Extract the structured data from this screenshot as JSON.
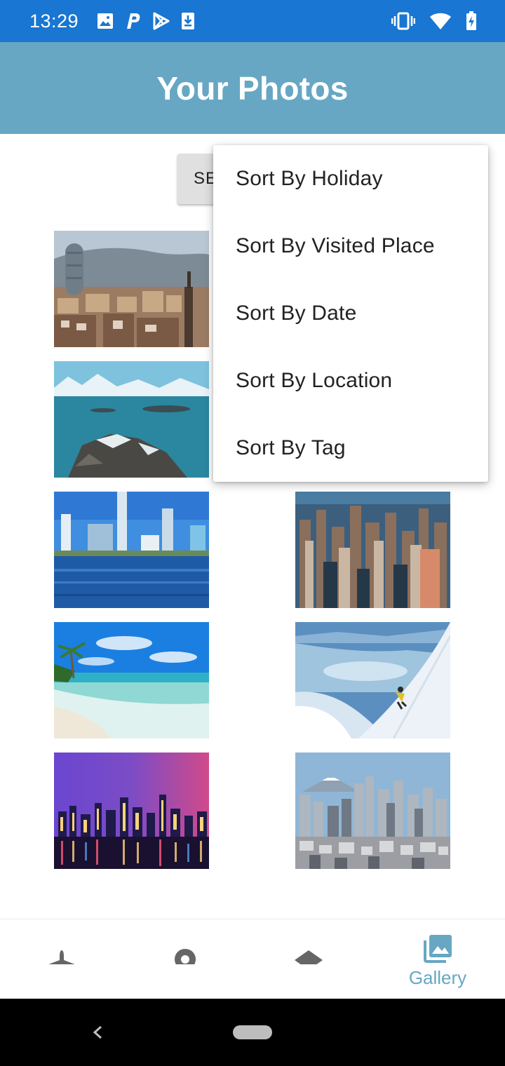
{
  "status_bar": {
    "time": "13:29",
    "left_icons": [
      "image-icon",
      "parking-icon",
      "play-store-icon",
      "download-icon"
    ],
    "right_icons": [
      "vibrate-icon",
      "wifi-icon",
      "battery-charging-icon"
    ]
  },
  "app_bar": {
    "title": "Your Photos"
  },
  "select_button": {
    "label": "SE"
  },
  "dropdown": {
    "items": [
      "Sort By Holiday",
      "Sort By Visited Place",
      "Sort By Date",
      "Sort By Location",
      "Sort By Tag"
    ]
  },
  "photos": [
    "barcelona-city-photo",
    "fjord-coast-photo",
    "lake-city-photo",
    "chicago-skyline-photo",
    "tropical-beach-photo",
    "skier-slope-photo",
    "night-skyline-photo",
    "tokyo-fuji-photo"
  ],
  "bottom_nav": {
    "items": [
      {
        "icon": "airplane-icon"
      },
      {
        "icon": "location-pin-icon"
      },
      {
        "icon": "layers-icon"
      },
      {
        "icon": "gallery-icon",
        "label": "Gallery"
      }
    ]
  },
  "colors": {
    "status_bar": "#1976d2",
    "app_bar": "#67a7c3",
    "accent": "#67a7c3",
    "inactive_icon": "#666666"
  }
}
